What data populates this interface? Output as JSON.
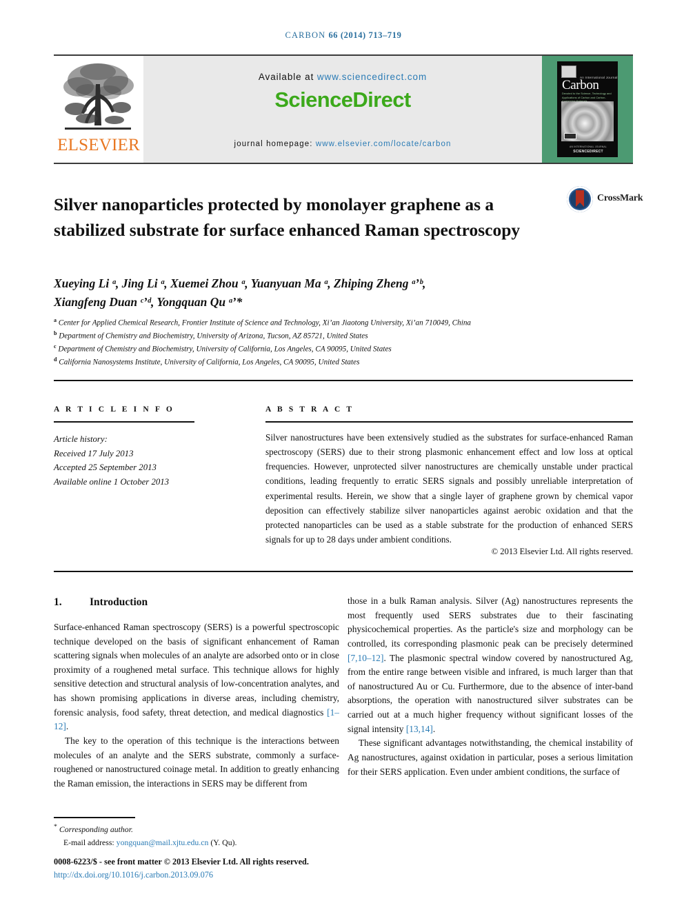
{
  "running_head": {
    "journal": "CARBON",
    "citation": "66 (2014) 713–719"
  },
  "masthead": {
    "publisher_logo_label": "ELSEVIER",
    "available_prefix": "Available at ",
    "available_url": "www.sciencedirect.com",
    "brand": "ScienceDirect",
    "homepage_prefix": "journal homepage: ",
    "homepage_url": "www.elsevier.com/locate/carbon",
    "cover": {
      "title": "Carbon",
      "superline": "An International Journal",
      "subtitle": "Devoted to the Science, Technology and Applications of Carbon and Carbon-Containing Materials",
      "footer_small": "AN INTERNATIONAL JOURNAL",
      "footer_brand": "SCIENCEDIRECT"
    }
  },
  "article": {
    "title": "Silver nanoparticles protected by monolayer graphene as a stabilized substrate for surface enhanced Raman spectroscopy",
    "crossmark_label": "CrossMark",
    "authors_line1": "Xueying Li ᵃ, Jing Li ᵃ, Xuemei Zhou ᵃ, Yuanyuan Ma ᵃ, Zhiping Zheng ᵃ’ᵇ,",
    "authors_line2": "Xiangfeng Duan ᶜ’ᵈ, Yongquan Qu ᵃ’*",
    "affiliations": [
      {
        "mark": "a",
        "text": "Center for Applied Chemical Research, Frontier Institute of Science and Technology, Xi’an Jiaotong University, Xi’an 710049, China"
      },
      {
        "mark": "b",
        "text": "Department of Chemistry and Biochemistry, University of Arizona, Tucson, AZ 85721, United States"
      },
      {
        "mark": "c",
        "text": "Department of Chemistry and Biochemistry, University of California, Los Angeles, CA 90095, United States"
      },
      {
        "mark": "d",
        "text": "California Nanosystems Institute, University of California, Los Angeles, CA 90095, United States"
      }
    ]
  },
  "article_info": {
    "heading": "A R T I C L E   I N F O",
    "history_label": "Article history:",
    "received": "Received 17 July 2013",
    "accepted": "Accepted 25 September 2013",
    "available_online": "Available online 1 October 2013"
  },
  "abstract": {
    "heading": "A B S T R A C T",
    "body": "Silver nanostructures have been extensively studied as the substrates for surface-enhanced Raman spectroscopy (SERS) due to their strong plasmonic enhancement effect and low loss at optical frequencies. However, unprotected silver nanostructures are chemically unstable under practical conditions, leading frequently to erratic SERS signals and possibly unreliable interpretation of experimental results. Herein, we show that a single layer of graphene grown by chemical vapor deposition can effectively stabilize silver nanoparticles against aerobic oxidation and that the protected nanoparticles can be used as a stable substrate for the production of enhanced SERS signals for up to 28 days under ambient conditions.",
    "copyright": "© 2013 Elsevier Ltd. All rights reserved."
  },
  "body": {
    "section_number": "1.",
    "section_title": "Introduction",
    "left_p1": "Surface-enhanced Raman spectroscopy (SERS) is a powerful spectroscopic technique developed on the basis of significant enhancement of Raman scattering signals when molecules of an analyte are adsorbed onto or in close proximity of a roughened metal surface. This technique allows for highly sensitive detection and structural analysis of low-concentration analytes, and has shown promising applications in diverse areas, including chemistry, forensic analysis, food safety, threat detection, and medical diagnostics ",
    "left_p1_ref": "[1–12]",
    "left_p1_tail": ".",
    "left_p2": "The key to the operation of this technique is the interactions between molecules of an analyte and the SERS substrate, commonly a surface-roughened or nanostructured coinage metal. In addition to greatly enhancing the Raman emission, the interactions in SERS may be different from",
    "right_p1a": "those in a bulk Raman analysis. Silver (Ag) nanostructures represents the most frequently used SERS substrates due to their fascinating physicochemical properties. As the particle's size and morphology can be controlled, its corresponding plasmonic peak can be precisely determined ",
    "right_p1a_ref": "[7,10–12]",
    "right_p1b": ". The plasmonic spectral window covered by nanostructured Ag, from the entire range between visible and infrared, is much larger than that of nanostructured Au or Cu. Furthermore, due to the absence of inter-band absorptions, the operation with nanostructured silver substrates can be carried out at a much higher frequency without significant losses of the signal intensity ",
    "right_p1b_ref": "[13,14]",
    "right_p1c": ".",
    "right_p2": "These significant advantages notwithstanding, the chemical instability of Ag nanostructures, against oxidation in particular, poses a serious limitation for their SERS application. Even under ambient conditions, the surface of"
  },
  "footer": {
    "corresponding": "Corresponding author.",
    "email_label": "E-mail address: ",
    "email": "yongquan@mail.xjtu.edu.cn",
    "email_suffix": " (Y. Qu).",
    "front_matter": "0008-6223/$ - see front matter © 2013 Elsevier Ltd. All rights reserved.",
    "doi": "http://dx.doi.org/10.1016/j.carbon.2013.09.076"
  },
  "colors": {
    "link": "#2a7bb5",
    "brand_green": "#3CA91B",
    "elsevier_orange": "#E87722",
    "cover_green": "#4c9a72",
    "crossmark_red": "#b5301f"
  }
}
